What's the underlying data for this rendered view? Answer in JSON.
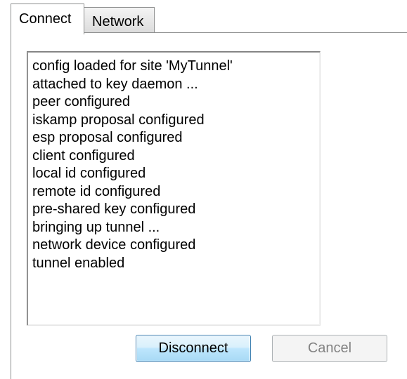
{
  "tabs": [
    {
      "label": "Connect",
      "active": true
    },
    {
      "label": "Network",
      "active": false
    }
  ],
  "log": {
    "lines": [
      "config loaded for site 'MyTunnel'",
      "attached to key daemon ...",
      "peer configured",
      "iskamp proposal configured",
      "esp proposal configured",
      "client configured",
      "local id configured",
      "remote id configured",
      "pre-shared key configured",
      "bringing up tunnel ...",
      "network device configured",
      "tunnel enabled"
    ]
  },
  "buttons": {
    "disconnect": {
      "label": "Disconnect",
      "enabled": true
    },
    "cancel": {
      "label": "Cancel",
      "enabled": false
    }
  },
  "colors": {
    "border": "#8e8f8f",
    "button_focus_border": "#3c7fb1",
    "disabled_text": "#838383"
  }
}
